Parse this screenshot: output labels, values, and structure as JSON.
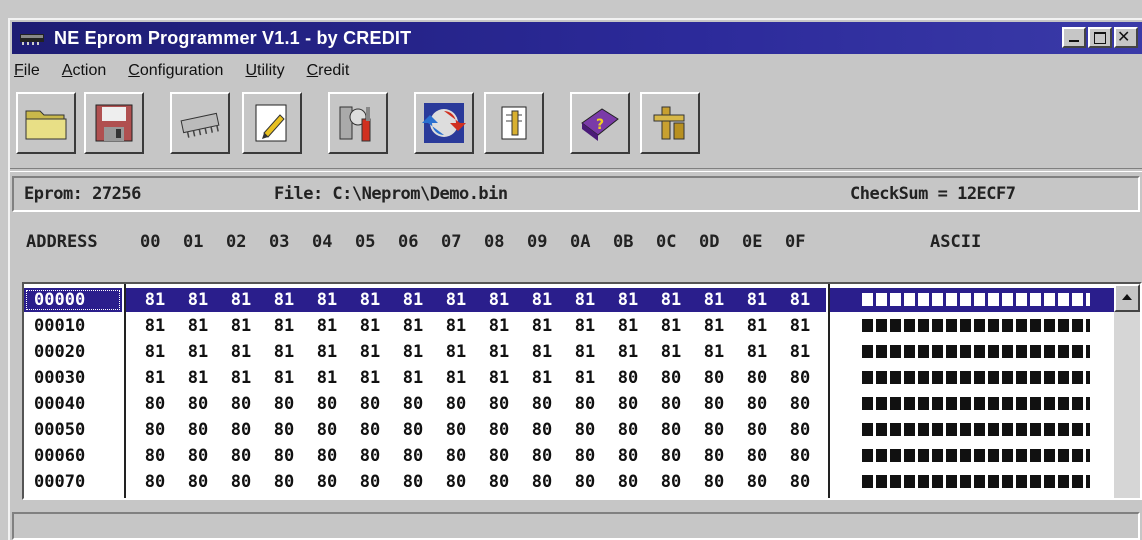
{
  "window": {
    "title": "NE Eprom Programmer V1.1  -  by CREDIT"
  },
  "menu": [
    {
      "first": "F",
      "rest": "ile"
    },
    {
      "first": "A",
      "rest": "ction"
    },
    {
      "first": "C",
      "rest": "onfiguration"
    },
    {
      "first": "U",
      "rest": "tility"
    },
    {
      "first": "C",
      "rest": "redit"
    }
  ],
  "toolbar": {
    "icons": [
      "open-folder-icon",
      "save-disk-icon",
      "eprom-chip-icon",
      "edit-pencil-icon",
      "tools-config-icon",
      "refresh-read-icon",
      "document-write-icon",
      "help-book-icon",
      "plumbing-exit-icon"
    ]
  },
  "info": {
    "eprom": "Eprom:  27256",
    "file": "File: C:\\Neprom\\Demo.bin",
    "checksum": "CheckSum = 12ECF7"
  },
  "header": {
    "address": "ADDRESS",
    "cols": [
      "00",
      "01",
      "02",
      "03",
      "04",
      "05",
      "06",
      "07",
      "08",
      "09",
      "0A",
      "0B",
      "0C",
      "0D",
      "0E",
      "0F"
    ],
    "ascii": "ASCII"
  },
  "rows": [
    {
      "addr": "00000",
      "bytes": [
        "81",
        "81",
        "81",
        "81",
        "81",
        "81",
        "81",
        "81",
        "81",
        "81",
        "81",
        "81",
        "81",
        "81",
        "81",
        "81"
      ],
      "selected": true
    },
    {
      "addr": "00010",
      "bytes": [
        "81",
        "81",
        "81",
        "81",
        "81",
        "81",
        "81",
        "81",
        "81",
        "81",
        "81",
        "81",
        "81",
        "81",
        "81",
        "81"
      ]
    },
    {
      "addr": "00020",
      "bytes": [
        "81",
        "81",
        "81",
        "81",
        "81",
        "81",
        "81",
        "81",
        "81",
        "81",
        "81",
        "81",
        "81",
        "81",
        "81",
        "81"
      ]
    },
    {
      "addr": "00030",
      "bytes": [
        "81",
        "81",
        "81",
        "81",
        "81",
        "81",
        "81",
        "81",
        "81",
        "81",
        "81",
        "80",
        "80",
        "80",
        "80",
        "80"
      ]
    },
    {
      "addr": "00040",
      "bytes": [
        "80",
        "80",
        "80",
        "80",
        "80",
        "80",
        "80",
        "80",
        "80",
        "80",
        "80",
        "80",
        "80",
        "80",
        "80",
        "80"
      ]
    },
    {
      "addr": "00050",
      "bytes": [
        "80",
        "80",
        "80",
        "80",
        "80",
        "80",
        "80",
        "80",
        "80",
        "80",
        "80",
        "80",
        "80",
        "80",
        "80",
        "80"
      ]
    },
    {
      "addr": "00060",
      "bytes": [
        "80",
        "80",
        "80",
        "80",
        "80",
        "80",
        "80",
        "80",
        "80",
        "80",
        "80",
        "80",
        "80",
        "80",
        "80",
        "80"
      ]
    },
    {
      "addr": "00070",
      "bytes": [
        "80",
        "80",
        "80",
        "80",
        "80",
        "80",
        "80",
        "80",
        "80",
        "80",
        "80",
        "80",
        "80",
        "80",
        "80",
        "80"
      ]
    }
  ],
  "colors": {
    "titlebar": "#2c2a9a",
    "selection": "#2a1e8c",
    "face": "#c6c6c6"
  }
}
